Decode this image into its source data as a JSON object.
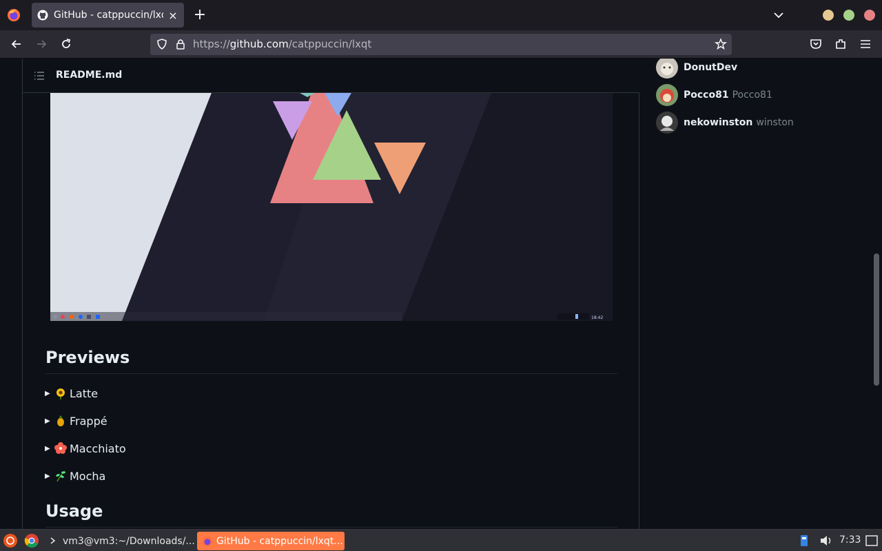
{
  "browser": {
    "tab_title": "GitHub - catppuccin/lxqt",
    "url_prefix": "https://",
    "url_host": "github.com",
    "url_path": "/catppuccin/lxqt",
    "window_buttons": [
      "#e5c890",
      "#a6d189",
      "#e78284"
    ]
  },
  "readme": {
    "filename": "README.md",
    "preview_clock": "18:42"
  },
  "previews": {
    "heading": "Previews",
    "flavors": [
      {
        "label": "Latte",
        "icon": "sunflower-emoji"
      },
      {
        "label": "Frappé",
        "icon": "pineapple-emoji"
      },
      {
        "label": "Macchiato",
        "icon": "hibiscus-emoji"
      },
      {
        "label": "Mocha",
        "icon": "herb-emoji"
      }
    ]
  },
  "usage": {
    "heading": "Usage"
  },
  "contributors": [
    {
      "login": "DonutDev",
      "name": ""
    },
    {
      "login": "Pocco81",
      "name": "Pocco81"
    },
    {
      "login": "nekowinston",
      "name": "winston"
    }
  ],
  "taskbar": {
    "terminal_task": "vm3@vm3:~/Downloads/...",
    "browser_task": "GitHub - catppuccin/lxqt...",
    "clock": "7:33"
  }
}
